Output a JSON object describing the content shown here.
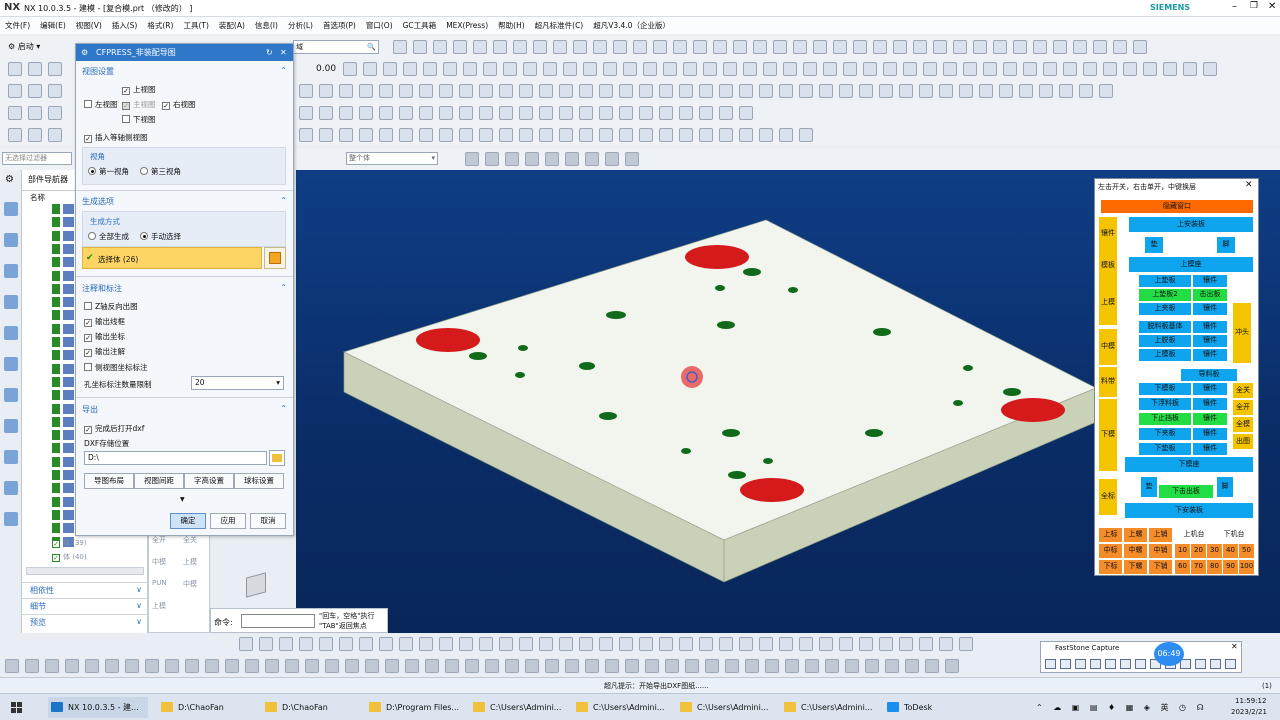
{
  "title": {
    "app": "NX 10.0.3.5 - 建模 - [复合模.prt （修改的） ]",
    "brand": "SIEMENS"
  },
  "menu": [
    "文件(F)",
    "编辑(E)",
    "视图(V)",
    "插入(S)",
    "格式(R)",
    "工具(T)",
    "装配(A)",
    "信息(I)",
    "分析(L)",
    "首选项(P)",
    "窗口(O)",
    "GC工具箱",
    "MEX(Press)",
    "帮助(H)",
    "超凡标准件(C)",
    "超凡V3.4.0（企业版）"
  ],
  "toolbar": {
    "start": "启动",
    "filter": "无选择过滤器",
    "entire": "整个体",
    "search_hint": "搜索",
    "zero": "0.00"
  },
  "nav": {
    "title": "部件导航器",
    "col": "名称",
    "body39": "体 (39)",
    "body40": "体 (40)",
    "sections": [
      "相依性",
      "细节",
      "预览"
    ]
  },
  "dialog": {
    "title": "CFPRESS_非装配导图",
    "sec_view": "视图设置",
    "top": "上视图",
    "left": "左视图",
    "front": "主视图",
    "right": "右视图",
    "bottom": "下视图",
    "iso": "插入等轴侧视图",
    "angle_label": "视角",
    "first": "第一视角",
    "third": "第三视角",
    "sec_gen": "生成选项",
    "gen_label": "生成方式",
    "all": "全部生成",
    "manual": "手动选择",
    "select": "选择体 (26)",
    "sec_anno": "注释和标注",
    "z": "Z轴反向出图",
    "frame": "输出线框",
    "coord": "输出坐标",
    "note": "输出注解",
    "sidecoord": "侧视图坐标标注",
    "holelimit_label": "孔坐标标注数量限制",
    "holelimit": "20",
    "sec_export": "导出",
    "opendxf": "完成后打开dxf",
    "dxfloc": "DXF存储位置",
    "path": "D:\\",
    "b_layout": "导图布局",
    "b_spacing": "视图间距",
    "b_font": "字高设置",
    "b_ball": "球标设置",
    "ok": "确定",
    "apply": "应用",
    "cancel": "取消"
  },
  "rpanel": {
    "header": "左击开关，右击单开，中键换层",
    "hide": "隐藏窗口",
    "l_kuai": "镶件",
    "l_mb": "模板",
    "l_up": "上模",
    "l_mid": "中模",
    "l_dn": "下模",
    "l_lcr": "料带",
    "l_xd": "全标",
    "r_ct": "冲头",
    "up_plate": "上安装板",
    "dian": "垫",
    "jiao": "脚",
    "up_seat": "上模座",
    "r1": [
      "上垫板",
      "镶件"
    ],
    "r2": [
      "上垫板2",
      "击出板"
    ],
    "r3": [
      "上夹板",
      "镶件"
    ],
    "r4": [
      "脱料板基体",
      "镶件"
    ],
    "r5": [
      "上脱板",
      "镶件"
    ],
    "r6": [
      "上模板",
      "镶件"
    ],
    "guide": "导料板",
    "r7": [
      "下模板",
      "镶件"
    ],
    "r8": [
      "下浮料板",
      "镶件"
    ],
    "r9": [
      "下止挡板",
      "镶件"
    ],
    "r10": [
      "下夹板",
      "镶件"
    ],
    "r11": [
      "下垫板",
      "镶件"
    ],
    "dn_seat": "下模座",
    "dn_strike": "下击出板",
    "dn_plate": "下安装板",
    "side": [
      "全关",
      "全开",
      "全模",
      "出图"
    ],
    "grid_rows": [
      [
        "上标",
        "上螺",
        "上销"
      ],
      [
        "中标",
        "中螺",
        "中销"
      ],
      [
        "下标",
        "下螺",
        "下销"
      ]
    ],
    "machine": [
      "上机台",
      "下机台"
    ],
    "nums": [
      [
        "10",
        "20",
        "30",
        "40",
        "50"
      ],
      [
        "60",
        "70",
        "80",
        "90",
        "100"
      ]
    ]
  },
  "cmd": {
    "label": "命令:",
    "hint1": "\"回车，空格\"执行",
    "hint2": "\"TAB\"返回焦点"
  },
  "status": "超凡提示：开始导出DXF图纸......",
  "fastone": {
    "title": "FastStone Capture",
    "time": "06:49",
    "view": "查看"
  },
  "palette": [
    "全开",
    "全关",
    "中模",
    "上模",
    "PUN",
    "中模",
    "上模"
  ],
  "taskbar": {
    "items": [
      "NX 10.0.3.5 - 建...",
      "D:\\ChaoFan",
      "D:\\ChaoFan",
      "D:\\Program Files...",
      "C:\\Users\\Admini...",
      "C:\\Users\\Admini...",
      "C:\\Users\\Admini...",
      "C:\\Users\\Admini...",
      "ToDesk"
    ],
    "clock": "11:59:12",
    "date": "2023/2/21",
    "count": "(1)"
  },
  "colors": {
    "accent": "#2f77c8",
    "viewport": "#0f3e85",
    "hole_red": "#d41a1a",
    "hole_green": "#0f6a1a"
  }
}
